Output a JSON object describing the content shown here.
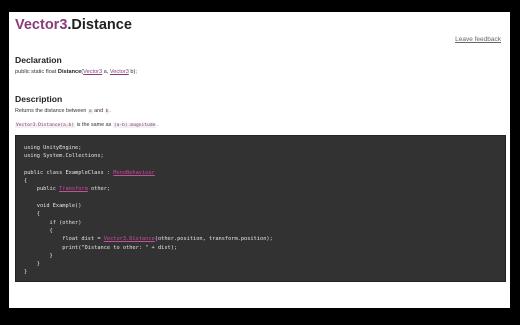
{
  "header": {
    "class_name": "Vector3",
    "member_name": ".Distance",
    "feedback_link": "Leave feedback"
  },
  "declaration": {
    "heading": "Declaration",
    "prefix": "public static float ",
    "method": "Distance",
    "open": "(",
    "type_a": "Vector3",
    "param_a": " a, ",
    "type_b": "Vector3",
    "param_b": " b);"
  },
  "description": {
    "heading": "Description",
    "text_before": "Returns the distance between ",
    "code_a": "a",
    "text_and": " and ",
    "code_b": "b",
    "text_after": ".",
    "expr_1": "Vector3.Distance(a,b)",
    "same_as": " is the same as ",
    "expr_2": "(a-b).magnitude",
    "same_after": "."
  },
  "code": {
    "line1": "using UnityEngine;",
    "line2": "using System.Collections;",
    "line3": "",
    "line4_pre": "public class ExampleClass : ",
    "line4_link": "MonoBehaviour",
    "line5": "{",
    "line6_pre": "    public ",
    "line6_link": "Transform",
    "line6_post": " other;",
    "line7": "",
    "line8": "    void Example()",
    "line9": "    {",
    "line10": "        if (other)",
    "line11": "        {",
    "line12_pre": "            float dist = ",
    "line12_link": "Vector3.Distance",
    "line12_post": "(other.position, transform.position);",
    "line13": "            print(\"Distance to other: \" + dist);",
    "line14": "        }",
    "line15": "    }",
    "line16": "}"
  }
}
